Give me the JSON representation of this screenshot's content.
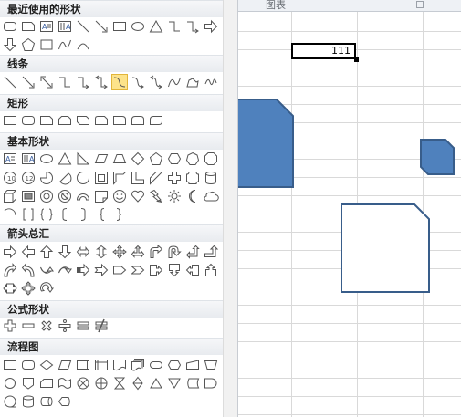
{
  "categories": [
    {
      "key": "recent",
      "label": "最近使用的形状"
    },
    {
      "key": "lines",
      "label": "线条"
    },
    {
      "key": "rect",
      "label": "矩形"
    },
    {
      "key": "basic",
      "label": "基本形状"
    },
    {
      "key": "arrows",
      "label": "箭头总汇"
    },
    {
      "key": "equation",
      "label": "公式形状"
    },
    {
      "key": "flowchart",
      "label": "流程图"
    }
  ],
  "worksheet": {
    "group_label": "图表",
    "cell_value": "111"
  },
  "colors": {
    "shape_fill": "#4f81bd",
    "shape_outline": "#385d8a",
    "highlight": "#fde38a",
    "gridline": "#d9d9d9",
    "header_gradient": "#e8ebef"
  },
  "icons": {
    "recent": [
      "rounded-rectangle-icon",
      "snip-corner-rectangle-icon",
      "text-box-icon",
      "vertical-text-box-icon",
      "line-icon",
      "arrow-line-icon",
      "rectangle-icon",
      "oval-icon",
      "triangle-icon",
      "elbow-connector-icon",
      "elbow-arrow-connector-icon",
      "right-arrow-icon",
      "down-arrow-icon",
      "pentagon-icon",
      "star-icon",
      "curve-icon",
      "freeform-curve-icon"
    ],
    "lines": [
      "line-icon",
      "arrow-line-icon",
      "double-arrow-line-icon",
      "elbow-connector-icon",
      "elbow-arrow-connector-icon",
      "elbow-double-arrow-connector-icon",
      "curved-connector-icon",
      "curved-arrow-connector-icon",
      "curved-double-arrow-connector-icon",
      "curve-icon",
      "freeform-icon",
      "scribble-icon"
    ],
    "rect": [
      "rectangle-icon",
      "rounded-rectangle-icon",
      "snip-single-corner-icon",
      "snip-same-side-icon",
      "snip-diagonal-icon",
      "snip-round-corner-icon",
      "round-single-corner-icon",
      "round-same-side-icon",
      "round-diagonal-icon"
    ],
    "basic": [
      "text-box-icon",
      "vertical-text-box-icon",
      "oval-icon",
      "triangle-icon",
      "right-triangle-icon",
      "parallelogram-icon",
      "trapezoid-icon",
      "diamond-icon",
      "pentagon-icon",
      "hexagon-icon",
      "heptagon-icon",
      "octagon-icon",
      "decagon-icon",
      "dodecagon-icon",
      "pie-icon",
      "chord-icon",
      "teardrop-icon",
      "frame-icon",
      "half-frame-icon",
      "l-shape-icon",
      "diagonal-stripe-icon",
      "cross-icon",
      "plaque-icon",
      "can-icon",
      "cube-icon",
      "bevel-icon",
      "donut-icon",
      "no-symbol-icon",
      "block-arc-icon",
      "folded-corner-icon",
      "smiley-face-icon",
      "heart-icon",
      "lightning-bolt-icon",
      "sun-icon",
      "moon-icon",
      "cloud-icon",
      "arc-icon",
      "double-bracket-icon",
      "double-brace-icon",
      "left-bracket-icon",
      "right-bracket-icon",
      "left-brace-icon",
      "right-brace-icon"
    ],
    "arrows": [
      "right-arrow-icon",
      "left-arrow-icon",
      "up-arrow-icon",
      "down-arrow-icon",
      "left-right-arrow-icon",
      "up-down-arrow-icon",
      "quad-arrow-icon",
      "left-right-up-arrow-icon",
      "bent-arrow-icon",
      "u-turn-arrow-icon",
      "left-up-arrow-icon",
      "bent-up-arrow-icon",
      "curved-right-arrow-icon",
      "curved-left-arrow-icon",
      "curved-up-arrow-icon",
      "curved-down-arrow-icon",
      "striped-right-arrow-icon",
      "notched-right-arrow-icon",
      "pentagon-arrow-icon",
      "chevron-arrow-icon",
      "right-arrow-callout-icon",
      "down-arrow-callout-icon",
      "left-arrow-callout-icon",
      "up-arrow-callout-icon",
      "left-right-arrow-callout-icon",
      "quad-arrow-callout-icon",
      "circular-arrow-icon"
    ],
    "equation": [
      "plus-icon",
      "minus-icon",
      "multiply-icon",
      "divide-icon",
      "equal-icon",
      "not-equal-icon"
    ],
    "flowchart": [
      "process-icon",
      "alternate-process-icon",
      "decision-icon",
      "data-icon",
      "predefined-process-icon",
      "internal-storage-icon",
      "document-icon",
      "multidocument-icon",
      "terminator-icon",
      "preparation-icon",
      "manual-input-icon",
      "manual-operation-icon",
      "connector-icon",
      "off-page-connector-icon",
      "card-icon",
      "punched-tape-icon",
      "summing-junction-icon",
      "or-icon",
      "collate-icon",
      "sort-icon",
      "extract-icon",
      "merge-icon",
      "stored-data-icon",
      "delay-icon",
      "sequential-access-storage-icon",
      "magnetic-disk-icon",
      "direct-access-storage-icon",
      "display-icon"
    ]
  }
}
